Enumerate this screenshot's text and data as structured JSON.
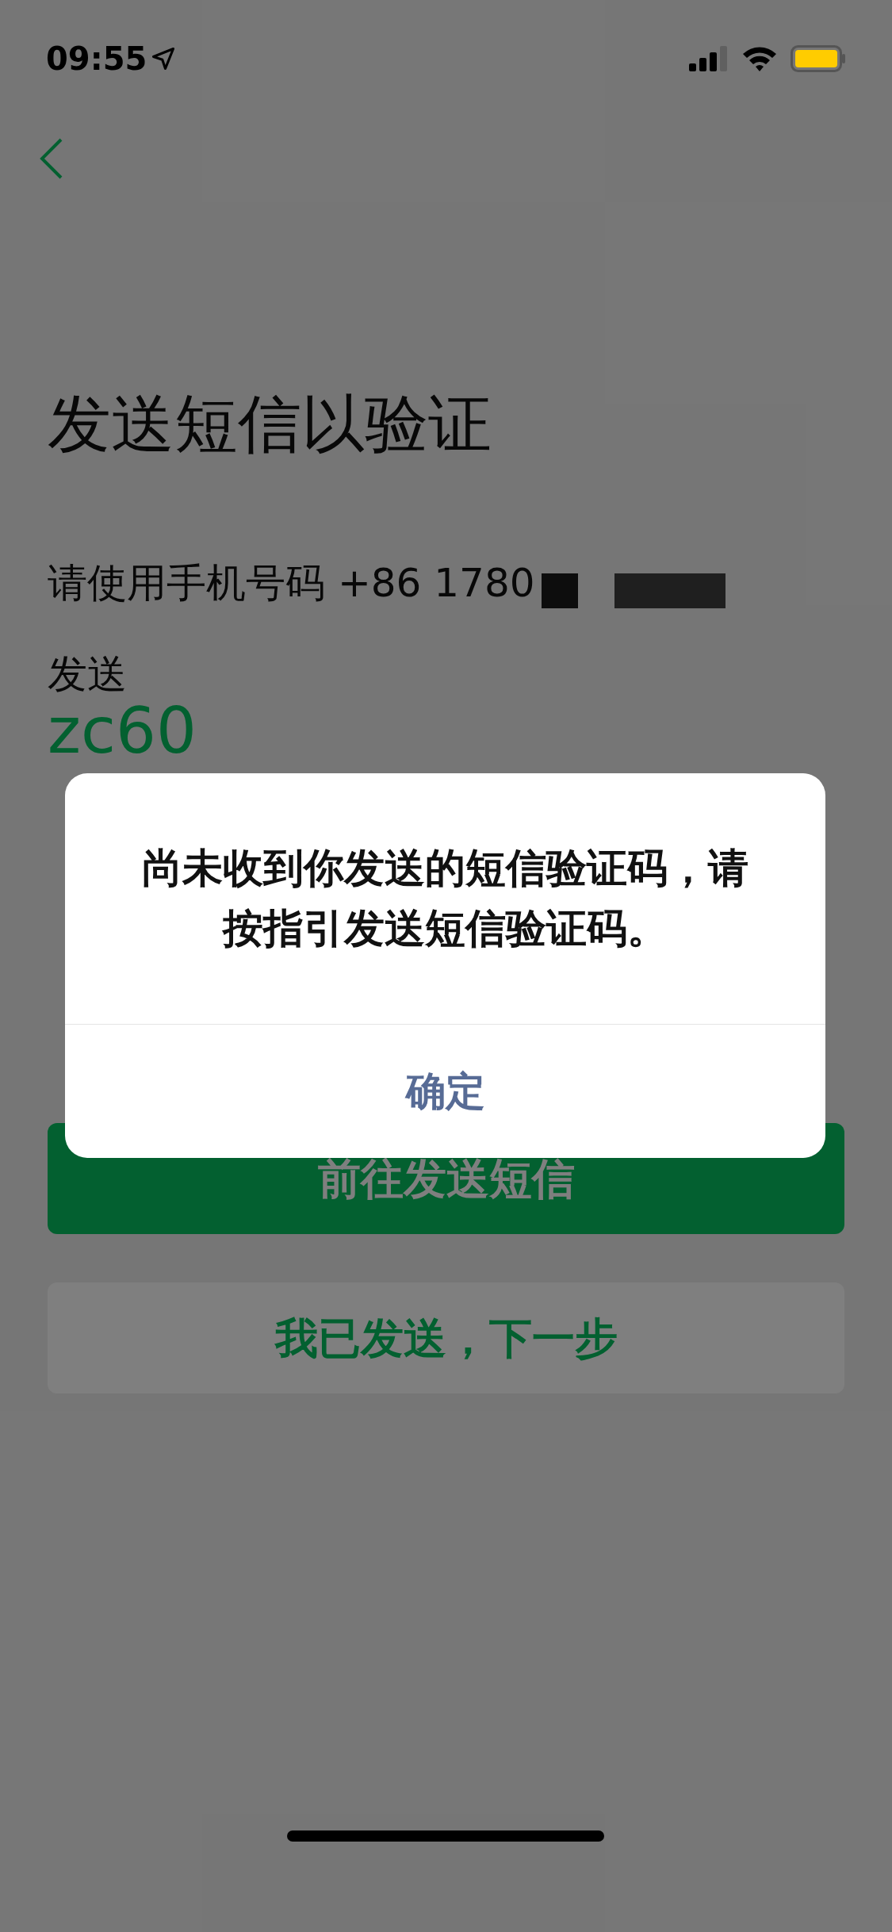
{
  "status_bar": {
    "time": "09:55"
  },
  "title": "发送短信以验证",
  "phone_line": "请使用手机号码 +86 1780",
  "send_label": "发送",
  "send_content": "zc60",
  "buttons": [
    {
      "label": "前往发送短信",
      "kind": "primary"
    },
    {
      "label": "我已发送，下一步",
      "kind": "secondary"
    }
  ],
  "dialog": {
    "message": "尚未收到你发送的短信验证码，请按指引发送短信验证码。",
    "button": "确定"
  }
}
